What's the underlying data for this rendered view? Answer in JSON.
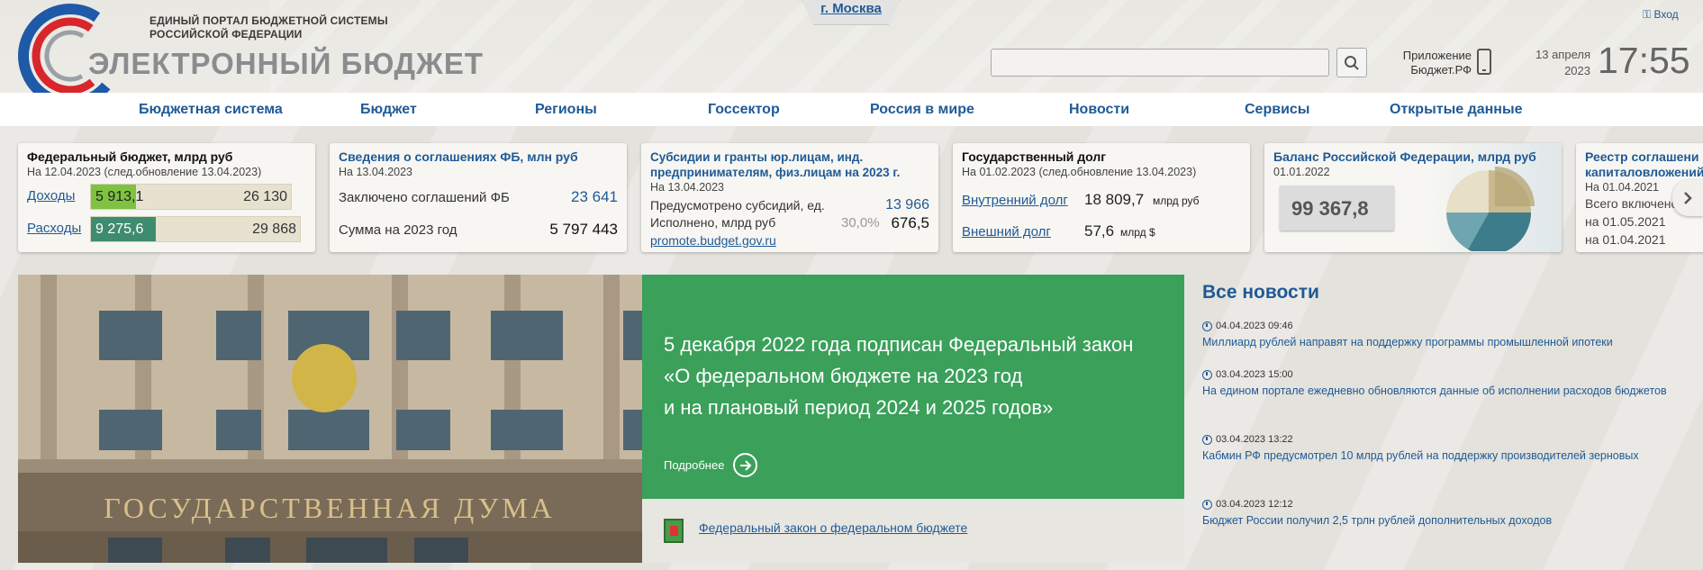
{
  "header": {
    "portal_line1": "ЕДИНЫЙ ПОРТАЛ БЮДЖЕТНОЙ СИСТЕМЫ",
    "portal_line2": "РОССИЙСКОЙ ФЕДЕРАЦИИ",
    "brand": "ЭЛЕКТРОННЫЙ БЮДЖЕТ",
    "city": "г. Москва",
    "login": "Вход",
    "app_line1": "Приложение",
    "app_line2": "Бюджет.РФ",
    "date_line1": "13 апреля",
    "date_line2": "2023",
    "time": "17:55",
    "search_placeholder": ""
  },
  "nav": [
    "Бюджетная система",
    "Бюджет",
    "Регионы",
    "Госсектор",
    "Россия в мире",
    "Новости",
    "Сервисы",
    "Открытые данные"
  ],
  "cards": {
    "federal_budget": {
      "title": "Федеральный бюджет, млрд руб",
      "subtitle": "На 12.04.2023 (след.обновление 13.04.2023)",
      "income_label": "Доходы",
      "income_value": "5 913,1",
      "income_total": "26 130",
      "income_ratio": 0.226,
      "expense_label": "Расходы",
      "expense_value": "9 275,6",
      "expense_total": "29 868",
      "expense_ratio": 0.31
    },
    "agreements": {
      "title": "Сведения о соглашениях ФБ, млн руб",
      "subtitle": "На 13.04.2023",
      "row1_label": "Заключено соглашений ФБ",
      "row1_value": "23 641",
      "row2_label": "Сумма на 2023 год",
      "row2_value": "5 797 443"
    },
    "subsidies": {
      "title": "Субсидии и гранты юр.лицам, инд. предпринимателям, физ.лицам на 2023 г.",
      "subtitle": "На 13.04.2023",
      "row1_label": "Предусмотрено субсидий, ед.",
      "row1_value": "13 966",
      "row2_label": "Исполнено, млрд руб",
      "row2_pct": "30,0%",
      "row2_value": "676,5",
      "link": "promote.budget.gov.ru"
    },
    "debt": {
      "title": "Государственный долг",
      "subtitle": "На 01.02.2023 (след.обновление 13.04.2023)",
      "row1_label": "Внутренний долг",
      "row1_value": "18 809,7",
      "row1_unit": "млрд руб",
      "row2_label": "Внешний долг",
      "row2_value": "57,6",
      "row2_unit": "млрд $"
    },
    "balance": {
      "title": "Баланс Российской Федерации, млрд руб",
      "subtitle": "01.01.2022",
      "value": "99 367,8"
    },
    "capital": {
      "title_line1": "Реестр соглашени",
      "title_line2": "капиталовложений",
      "subtitle": "На 01.04.2021",
      "line1": "Всего включено в",
      "line2": "на 01.05.2021",
      "line3": "на 01.04.2021"
    }
  },
  "hero": {
    "building_text": "ГОСУДАРСТВЕННАЯ ДУМА",
    "headline_line1": "5 декабря 2022 года подписан Федеральный закон",
    "headline_line2": "«О федеральном бюджете на 2023 год",
    "headline_line3": "и на плановый период 2024 и 2025 годов»",
    "more": "Подробнее",
    "doc_link": "Федеральный закон о федеральном бюджете"
  },
  "news": {
    "title": "Все новости",
    "items": [
      {
        "time": "04.04.2023 09:46",
        "text": "Миллиард рублей направят на поддержку программы промышленной ипотеки"
      },
      {
        "time": "03.04.2023 15:00",
        "text": "На едином портале ежедневно обновляются данные об исполнении расходов бюджетов"
      },
      {
        "time": "03.04.2023 13:22",
        "text": "Кабмин РФ предусмотрел 10 млрд рублей на поддержку производителей зерновых"
      },
      {
        "time": "03.04.2023 12:12",
        "text": "Бюджет России получил 2,5 трлн рублей дополнительных доходов"
      }
    ]
  },
  "colors": {
    "brand_blue": "#1f5a96",
    "hero_green": "#3aa05a",
    "income_green": "#7fc241",
    "expense_teal": "#3e8c6f"
  }
}
